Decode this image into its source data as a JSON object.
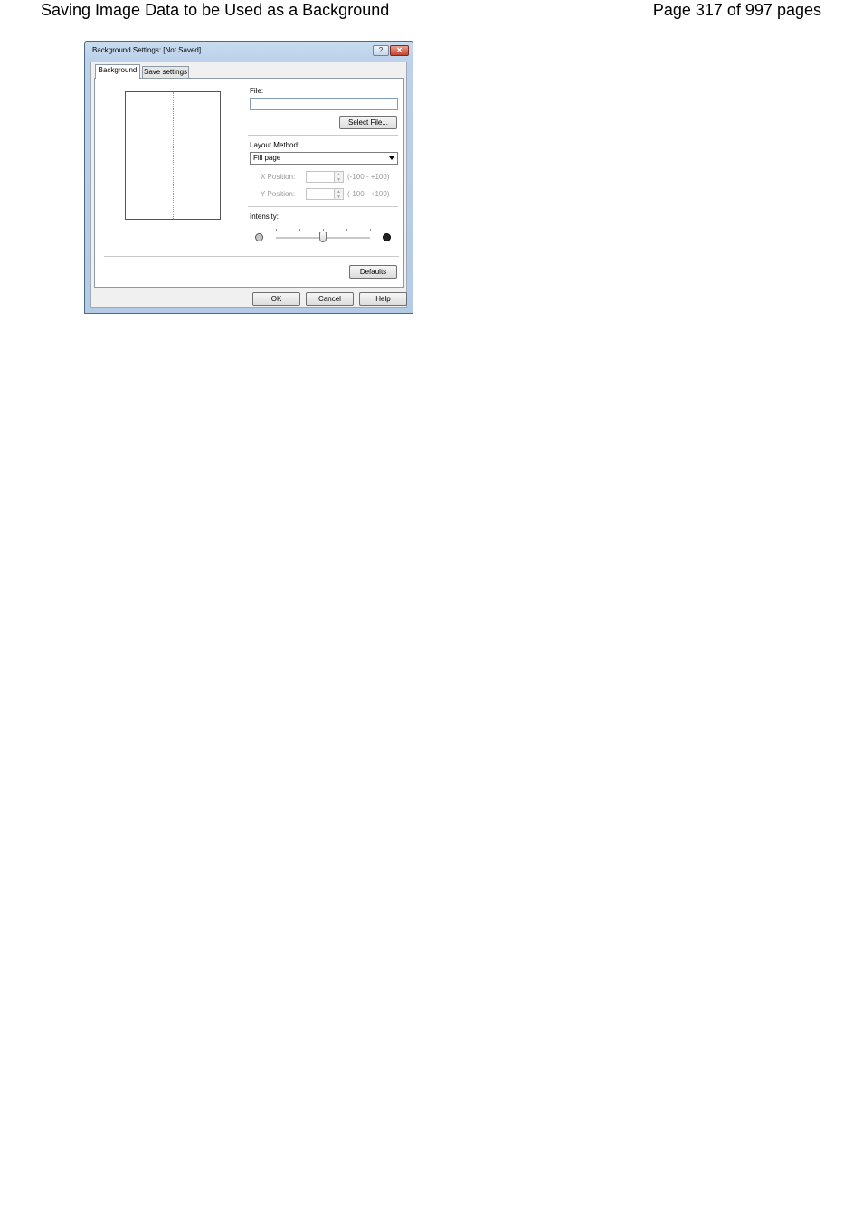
{
  "document": {
    "title": "Saving Image Data to be Used as a Background",
    "page_info": "Page 317 of 997 pages"
  },
  "dialog": {
    "title": "Background Settings: [Not Saved]",
    "help_glyph": "?",
    "close_glyph": "✕",
    "tabs": [
      {
        "label": "Background",
        "active": true
      },
      {
        "label": "Save settings",
        "active": false
      }
    ],
    "file": {
      "label": "File:",
      "value": "",
      "select_button": "Select File..."
    },
    "layout_method": {
      "label": "Layout Method:",
      "selected": "Fill page"
    },
    "x_position": {
      "label": "X Position:",
      "value": "",
      "range": "(-100 - +100)",
      "enabled": false
    },
    "y_position": {
      "label": "Y Position:",
      "value": "",
      "range": "(-100 - +100)",
      "enabled": false
    },
    "intensity": {
      "label": "Intensity:",
      "level_fraction": 0.5,
      "tick_count": 5
    },
    "buttons": {
      "defaults": "Defaults",
      "ok": "OK",
      "cancel": "Cancel",
      "help": "Help"
    }
  },
  "icons": {
    "light_intensity": "light-circle-icon",
    "dark_intensity": "dark-circle-icon",
    "dropdown": "chevron-down-icon",
    "spin_up": "▲",
    "spin_down": "▼"
  },
  "colors": {
    "titlebar": "#bcd2ea",
    "close_button": "#c5432c",
    "dialog_face": "#f0f0f0"
  }
}
